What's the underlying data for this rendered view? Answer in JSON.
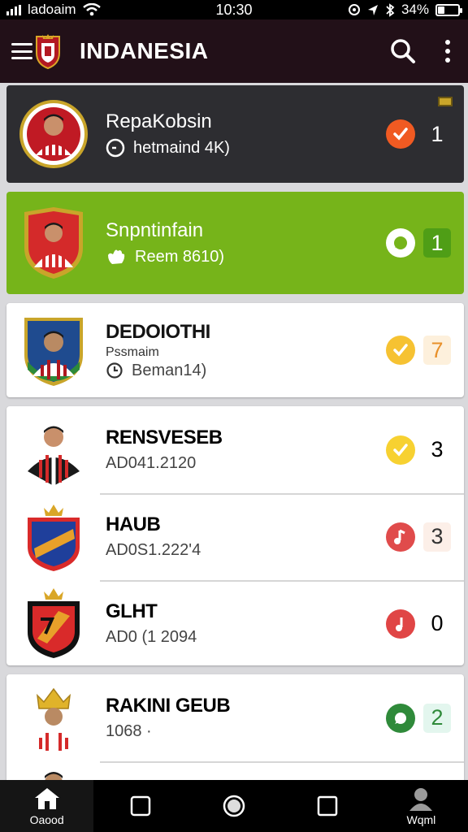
{
  "status_bar": {
    "carrier": "ladoaim",
    "time": "10:30",
    "battery": "34%",
    "battery_level": 0.34
  },
  "app_bar": {
    "title": "INDANESIA",
    "icons": [
      "menu-icon",
      "club-crest-icon",
      "search-icon",
      "more-vert-icon"
    ]
  },
  "items": [
    {
      "name": "RepaKobsin",
      "subtitle": "hetmaind 4K)",
      "sub_icon": "clock-icon",
      "status": "check",
      "status_color": "#f05a22",
      "count": "1"
    },
    {
      "name": "Snpntinfain",
      "subtitle": "Reem 8610)",
      "sub_icon": "hand-icon",
      "status": "chat",
      "status_color": "#ffffff",
      "count": "1"
    },
    {
      "name": "DEDOIOTHI",
      "role": "Pssmaim",
      "subtitle": "Beman14)",
      "sub_icon": "clock-icon",
      "status": "check",
      "status_color": "#f6c232",
      "count": "7"
    },
    {
      "name": "RENSVESEB",
      "subtitle": "AD041.2120",
      "status": "check",
      "status_color": "#f7d131",
      "count": "3"
    },
    {
      "name": "HAUB",
      "subtitle": "AD0S1.222'4",
      "status": "music",
      "status_color": "#e04b4b",
      "count": "3"
    },
    {
      "name": "GLHT",
      "subtitle": "AD0 (1 2094",
      "status": "music",
      "status_color": "#e04545",
      "count": "0"
    },
    {
      "name": "RAKINI GEUB",
      "subtitle": "1068 ·",
      "status": "chat",
      "status_color": "#2f8a3a",
      "count": "2"
    }
  ],
  "bottom_nav": [
    {
      "label": "Oaood",
      "icon": "home-icon",
      "active": true
    },
    {
      "label": "",
      "icon": "square-icon"
    },
    {
      "label": "",
      "icon": "circle-icon"
    },
    {
      "label": "",
      "icon": "square-icon"
    },
    {
      "label": "Wqml",
      "icon": "person-icon"
    }
  ],
  "colors": {
    "app_bar": "#221018",
    "highlight_green": "#76b41a",
    "dark_card": "#2d2d31",
    "background": "#d9d9dc"
  }
}
